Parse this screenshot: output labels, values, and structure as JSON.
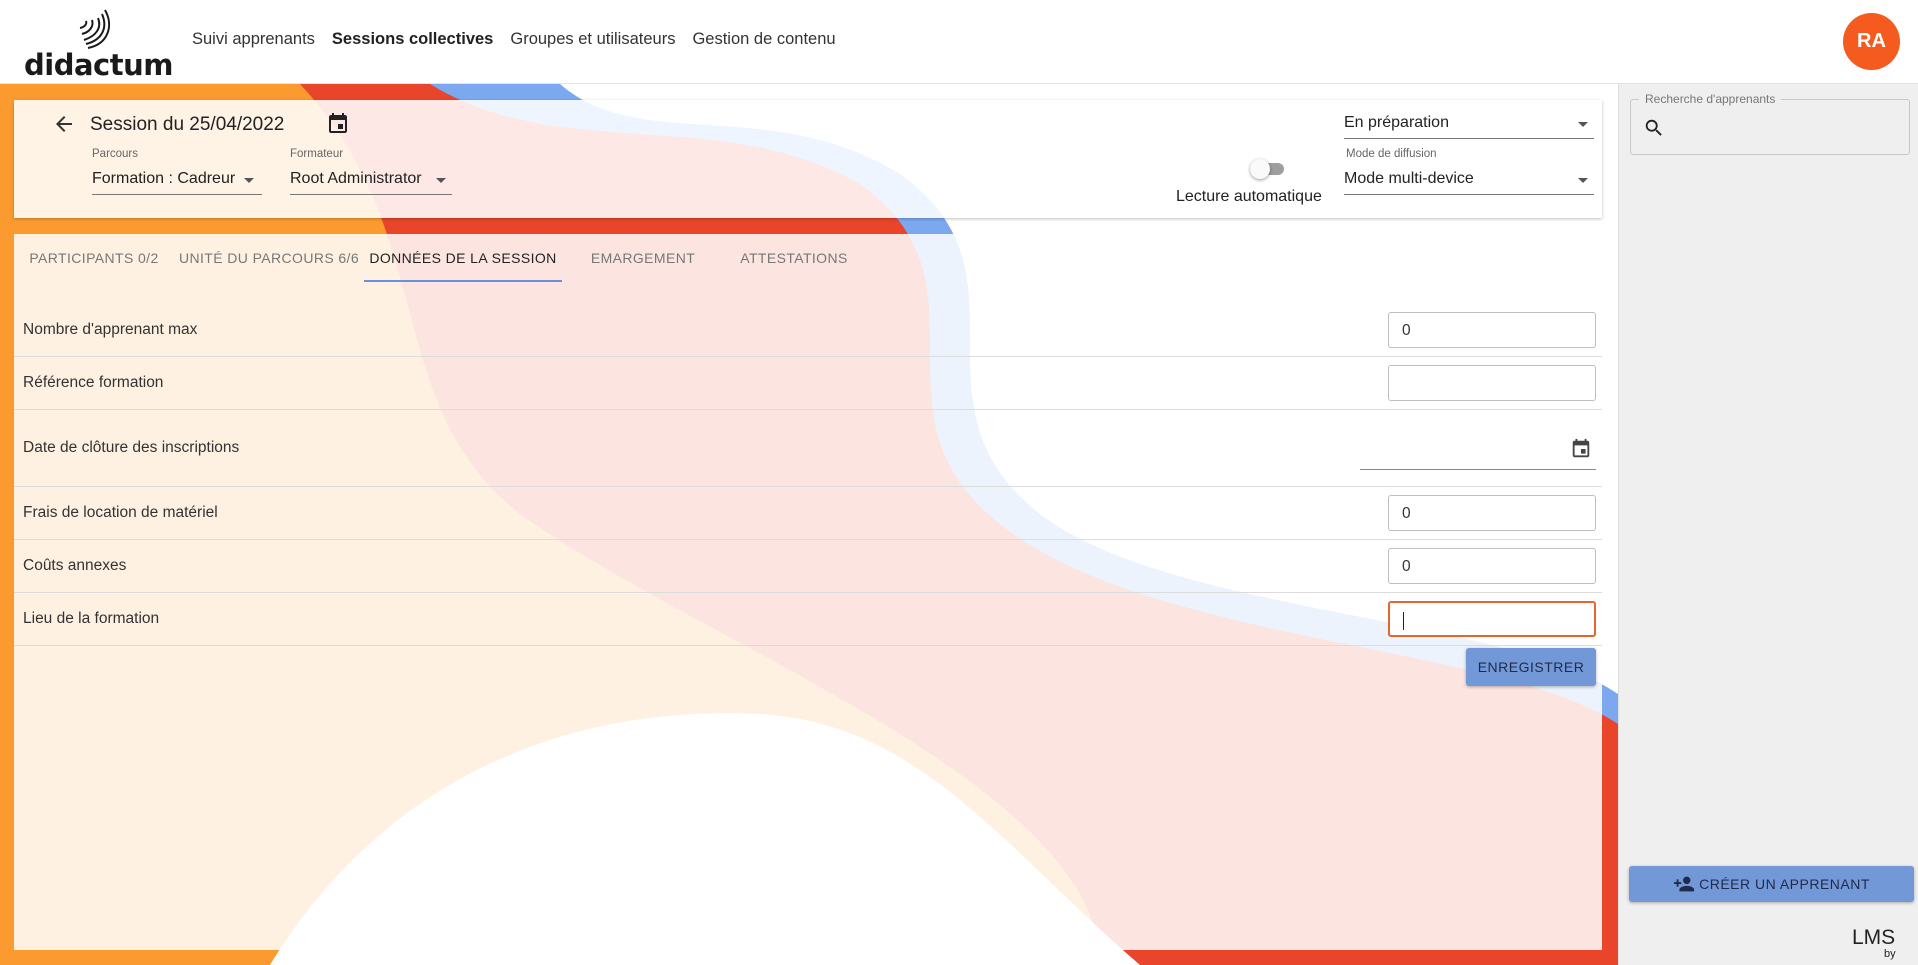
{
  "header": {
    "logo_text": "didactum",
    "nav": [
      {
        "label": "Suivi apprenants",
        "active": false
      },
      {
        "label": "Sessions collectives",
        "active": true
      },
      {
        "label": "Groupes et utilisateurs",
        "active": false
      },
      {
        "label": "Gestion de contenu",
        "active": false
      }
    ],
    "avatar_initials": "RA"
  },
  "session": {
    "title": "Session du 25/04/2022",
    "parcours_label": "Parcours",
    "parcours_value": "Formation : Cadreur",
    "formateur_label": "Formateur",
    "formateur_value": "Root Administrator",
    "autoplay_label": "Lecture automatique",
    "autoplay_on": false,
    "status_value": "En préparation",
    "diffusion_label": "Mode de diffusion",
    "diffusion_value": "Mode multi-device"
  },
  "tabs": [
    {
      "label": "PARTICIPANTS 0/2",
      "active": false
    },
    {
      "label": "UNITÉ DU PARCOURS 6/6",
      "active": false
    },
    {
      "label": "DONNÉES DE LA SESSION",
      "active": true
    },
    {
      "label": "EMARGEMENT",
      "active": false
    },
    {
      "label": "ATTESTATIONS",
      "active": false
    }
  ],
  "form": {
    "max_learners_label": "Nombre d'apprenant max",
    "max_learners_value": "0",
    "reference_label": "Référence formation",
    "reference_value": "",
    "closing_date_label": "Date de clôture des inscriptions",
    "closing_date_value": "",
    "equipment_label": "Frais de location de matériel",
    "equipment_value": "0",
    "extra_costs_label": "Coûts annexes",
    "extra_costs_value": "0",
    "location_label": "Lieu de la formation",
    "location_value": "",
    "save_label": "ENREGISTRER"
  },
  "sidebar": {
    "search_label": "Recherche d'apprenants",
    "search_value": "",
    "create_label": "CRÉER UN APPRENANT"
  },
  "footer": {
    "lms_text": "LMS",
    "by_text": "by"
  },
  "colors": {
    "accent_blue": "#7398d8",
    "avatar_orange": "#f55a1e",
    "focus_orange": "#e7642c",
    "bg_orange": "#fb9a2f",
    "bg_red": "#e8452a",
    "bg_blue": "#7ca8f0"
  },
  "icons": [
    "back-arrow-icon",
    "calendar-icon",
    "dropdown-caret-icon",
    "search-icon",
    "add-person-icon"
  ]
}
